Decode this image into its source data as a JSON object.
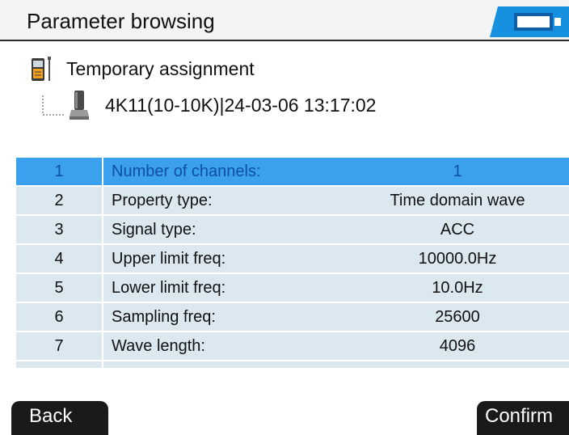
{
  "header": {
    "title": "Parameter browsing",
    "battery_icon": "battery-icon"
  },
  "tree": {
    "root": {
      "label": "Temporary assignment",
      "icon": "handheld-device-icon"
    },
    "child": {
      "label": "4K11(10-10K)|24-03-06 13:17:02",
      "icon": "sensor-icon"
    }
  },
  "table": {
    "selected_index": 0,
    "rows": [
      {
        "num": "1",
        "param": "Number of channels:",
        "value": "1"
      },
      {
        "num": "2",
        "param": "Property type:",
        "value": "Time domain wave"
      },
      {
        "num": "3",
        "param": "Signal type:",
        "value": "ACC"
      },
      {
        "num": "4",
        "param": "Upper limit freq:",
        "value": "10000.0Hz"
      },
      {
        "num": "5",
        "param": "Lower limit freq:",
        "value": "10.0Hz"
      },
      {
        "num": "6",
        "param": "Sampling freq:",
        "value": "25600"
      },
      {
        "num": "7",
        "param": "Wave length:",
        "value": "4096"
      }
    ]
  },
  "buttons": {
    "back": "Back",
    "confirm": "Confirm"
  },
  "colors": {
    "row_background": "#dbe8ef",
    "selected_row": "#3ba0ee",
    "selected_text": "#0d4fa6",
    "battery_blue": "#1890e0",
    "button_background": "#1a1a1a"
  }
}
